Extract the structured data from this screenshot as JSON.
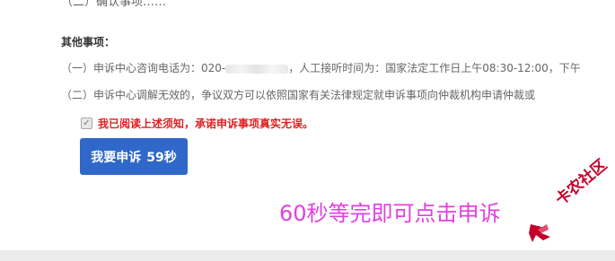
{
  "cut_off_text": "（二）确认事项……",
  "section": {
    "title": "其他事项："
  },
  "notices": {
    "line1_prefix": "（一）申诉中心咨询电话为：",
    "line1_phone_visible": "020-",
    "line1_suffix": "，人工接听时间为：国家法定工作日上午08:30-12:00，下午",
    "line2": "（二）申诉中心调解无效的，争议双方可以依照国家有关法律规定就申诉事项向仲裁机构申请仲裁或"
  },
  "agreement": {
    "checked": true,
    "label": "我已阅读上述须知，承诺申诉事项真实无误。"
  },
  "submit": {
    "label": "我要申诉",
    "countdown": "59秒"
  },
  "overlay_hint": "60秒等完即可点击申诉",
  "watermark": {
    "text": "卡农社区"
  },
  "colors": {
    "primary_button": "#2f68c8",
    "warning_text": "#e02020",
    "hint_text": "#e040e0",
    "watermark": "#c4002a"
  }
}
